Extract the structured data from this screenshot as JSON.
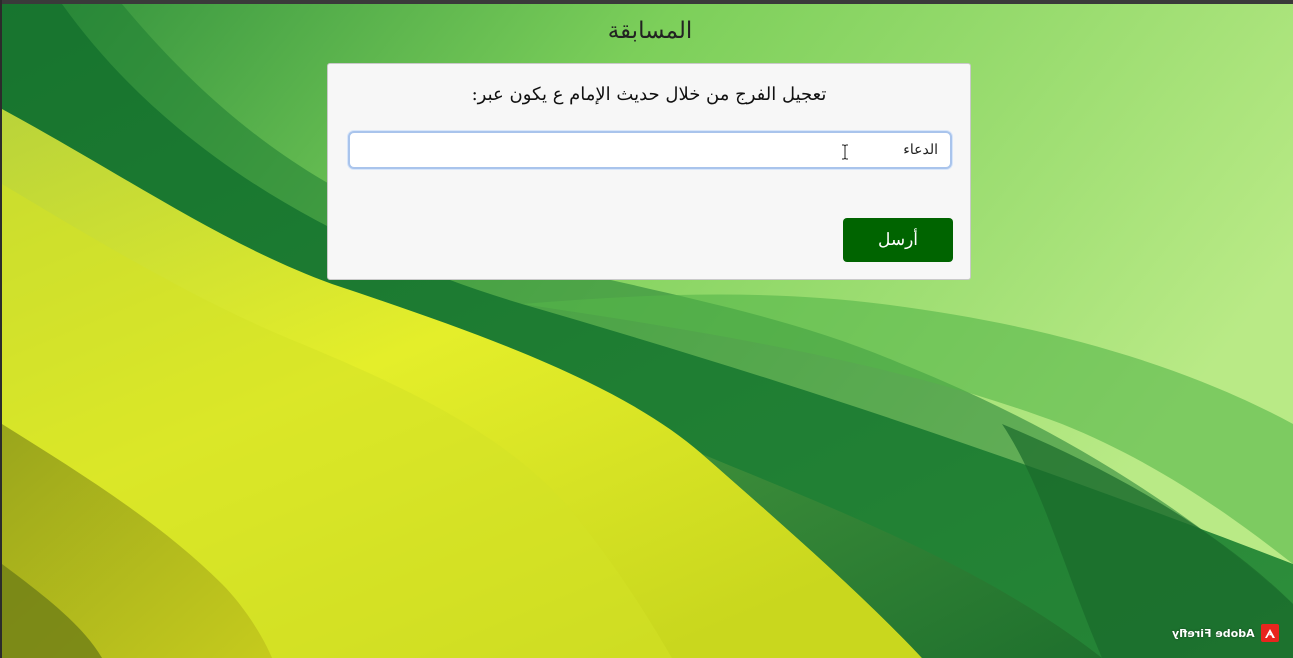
{
  "page": {
    "title": "المسابقة"
  },
  "quiz": {
    "question": "تعجيل الفرج من خلال حديث الإمام ع يكون عبر:",
    "answer_value": "الدعاء",
    "answer_placeholder": "",
    "submit_label": "أرسل"
  },
  "watermark": {
    "text": "Adobe Firefly",
    "icon": "adobe-logo-icon"
  },
  "colors": {
    "submit_button": "#006400",
    "input_border": "#a9c4ec",
    "card_background": "#f7f7f7"
  },
  "icons": {
    "text_cursor": "i-beam-cursor-icon"
  }
}
